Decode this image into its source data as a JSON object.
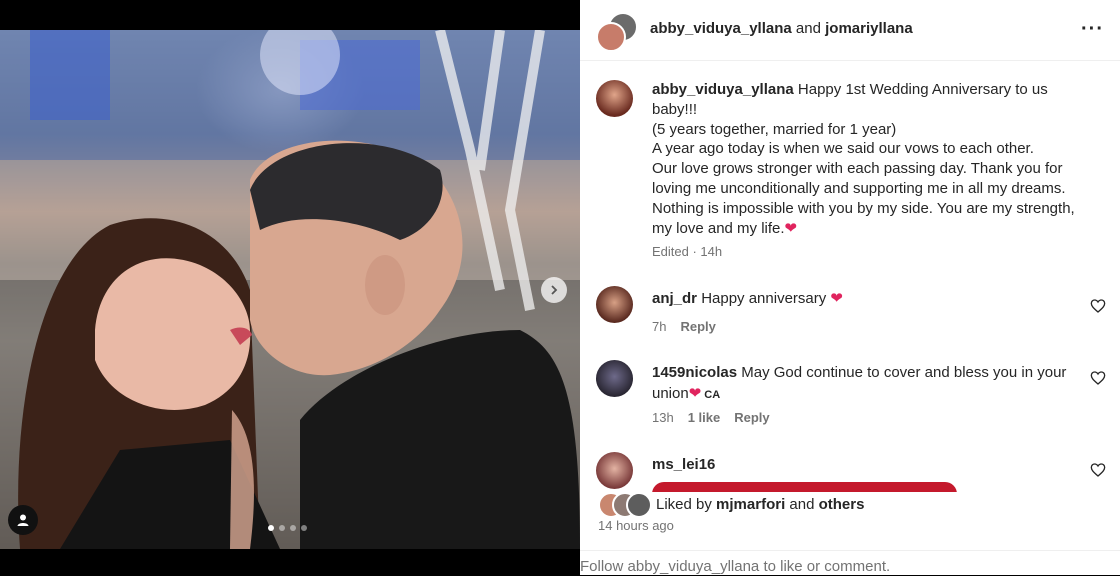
{
  "header": {
    "user1": "abby_viduya_yllana",
    "conjunction": "and",
    "user2": "jomariyllana",
    "more_icon": "more-horizontal-icon"
  },
  "caption": {
    "username": "abby_viduya_yllana",
    "text": " Happy 1st Wedding Anniversary to us baby!!!\n(5 years together, married for 1 year)\nA year ago today is when we said our vows to each other.\nOur love grows stronger with each passing day. Thank you for loving me unconditionally and supporting me in all my dreams. Nothing is impossible with you by my side. You are my strength, my love and my life.",
    "emoji": "❤",
    "meta": "Edited · 14h"
  },
  "comments": [
    {
      "username": "anj_dr",
      "text": "Happy anniversary",
      "emoji": "❤",
      "time": "7h",
      "likes": "",
      "reply": "Reply"
    },
    {
      "username": "1459nicolas",
      "text": "May God continue to cover and bless you in your union",
      "emoji": "❤",
      "flag": "CA",
      "time": "13h",
      "likes": "1 like",
      "reply": "Reply"
    },
    {
      "username": "ms_lei16",
      "text": "",
      "time": "",
      "likes": "",
      "reply": ""
    }
  ],
  "likes": {
    "prefix": "Liked by",
    "user": "mjmarfori",
    "conjunction": "and",
    "others": "others"
  },
  "timestamp": "14 hours ago",
  "footer": {
    "text": "Follow abby_viduya_yllana to like or comment."
  },
  "carousel": {
    "total": 4,
    "active": 1
  },
  "colors": {
    "heart": "#e0245e",
    "meta_gray": "#737373",
    "text": "#262626"
  }
}
